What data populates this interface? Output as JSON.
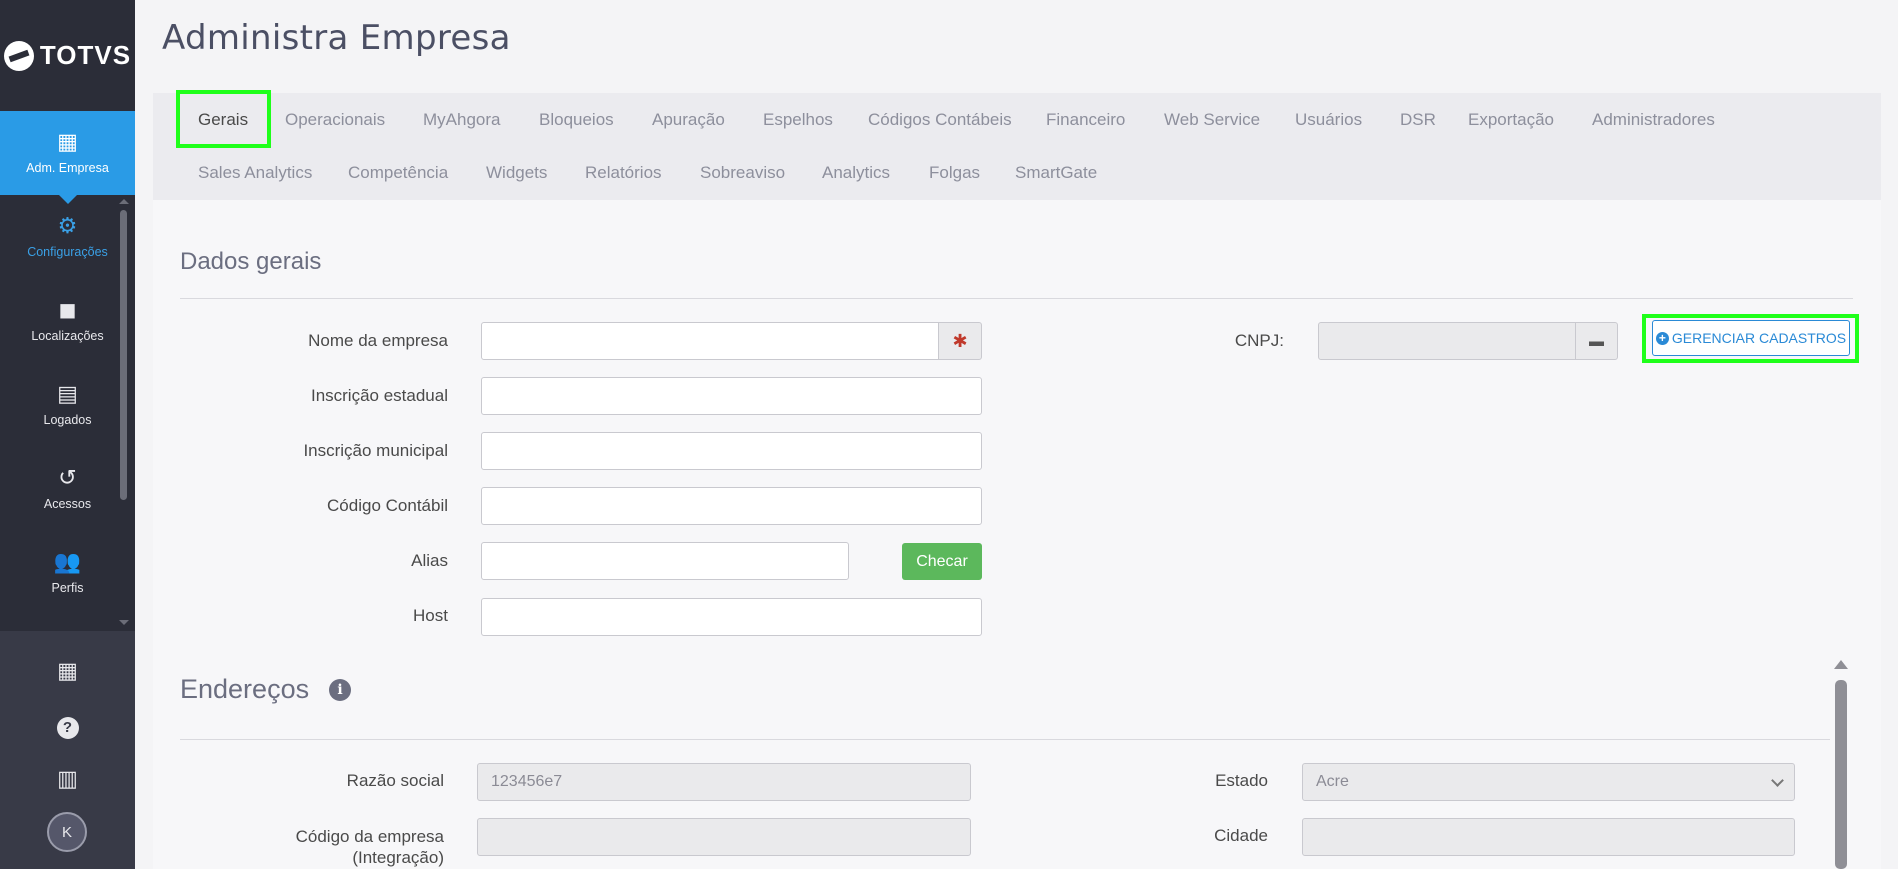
{
  "app": {
    "logo_text": "TOTVS"
  },
  "sidebar": {
    "items": [
      {
        "label": "Adm. Empresa",
        "icon": "building-settings-icon"
      },
      {
        "label": "Configurações",
        "icon": "gear-icon"
      },
      {
        "label": "Localizações",
        "icon": "tag-icon"
      },
      {
        "label": "Logados",
        "icon": "id-card-icon"
      },
      {
        "label": "Acessos",
        "icon": "history-icon"
      },
      {
        "label": "Perfis",
        "icon": "users-icon"
      }
    ],
    "bottom": {
      "avatar_initial": "K"
    }
  },
  "header": {
    "title": "Administra Empresa"
  },
  "tabs": [
    "Gerais",
    "Operacionais",
    "MyAhgora",
    "Bloqueios",
    "Apuração",
    "Espelhos",
    "Códigos Contábeis",
    "Financeiro",
    "Web Service",
    "Usuários",
    "DSR",
    "Exportação",
    "Administradores",
    "Sales Analytics",
    "Competência",
    "Widgets",
    "Relatórios",
    "Sobreaviso",
    "Analytics",
    "Folgas",
    "SmartGate"
  ],
  "dados_gerais": {
    "title": "Dados gerais",
    "fields": {
      "nome_empresa": {
        "label": "Nome da empresa",
        "value": ""
      },
      "inscricao_estadual": {
        "label": "Inscrição estadual",
        "value": ""
      },
      "inscricao_municipal": {
        "label": "Inscrição municipal",
        "value": ""
      },
      "codigo_contabil": {
        "label": "Código Contábil",
        "value": ""
      },
      "alias": {
        "label": "Alias",
        "value": ""
      },
      "host": {
        "label": "Host",
        "value": ""
      },
      "cnpj": {
        "label": "CNPJ:",
        "value": ""
      }
    },
    "required_mark": "✱",
    "checar_label": "Checar",
    "gerenciar_label": "GERENCIAR CADASTROS"
  },
  "enderecos": {
    "title": "Endereços",
    "info_glyph": "i",
    "fields": {
      "razao_social": {
        "label": "Razão social",
        "value": "123456e7"
      },
      "codigo_empresa": {
        "label": "Código da empresa (Integração)",
        "label_line1": "Código da empresa",
        "label_line2": "(Integração)",
        "value": ""
      },
      "estado": {
        "label": "Estado",
        "value": "Acre"
      },
      "cidade": {
        "label": "Cidade",
        "value": ""
      }
    }
  },
  "colors": {
    "sidebar_bg": "#2b2d38",
    "active_blue": "#2a9be6",
    "highlight_green": "#1fff1a",
    "checar_green": "#5cb85c",
    "link_blue": "#2a8ad6"
  }
}
